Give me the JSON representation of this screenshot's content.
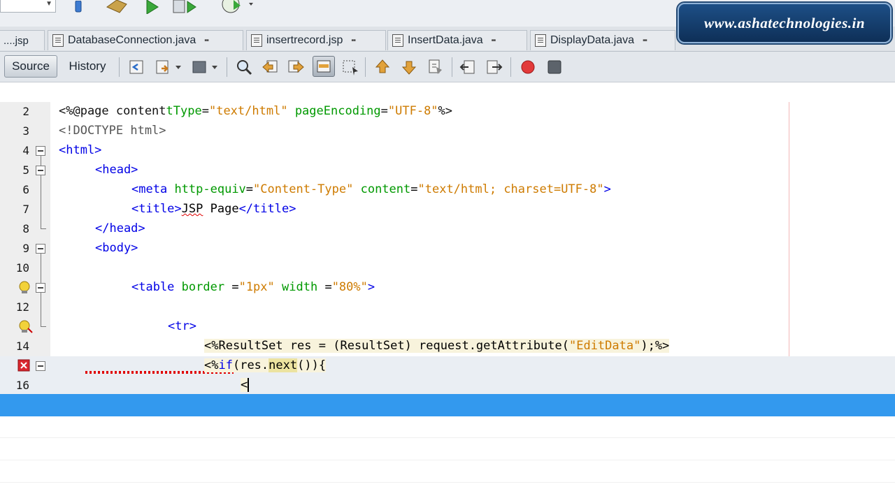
{
  "watermark": {
    "text": "www.ashatechnologies.in"
  },
  "tabs": [
    {
      "label": "....jsp"
    },
    {
      "label": "DatabaseConnection.java"
    },
    {
      "label": "insertrecord.jsp"
    },
    {
      "label": "InsertData.java"
    },
    {
      "label": "DisplayData.java"
    }
  ],
  "editor_toolbar": {
    "source_label": "Source",
    "history_label": "History"
  },
  "code_lines": [
    {
      "num": "2",
      "text": "<%@page contentType=\"text/html\" pageEncoding=\"UTF-8\"%>"
    },
    {
      "num": "3",
      "text": "<!DOCTYPE html>"
    },
    {
      "num": "4",
      "text": "<html>"
    },
    {
      "num": "5",
      "text": "<head>"
    },
    {
      "num": "6",
      "text": "<meta http-equiv=\"Content-Type\" content=\"text/html; charset=UTF-8\">"
    },
    {
      "num": "7",
      "text": "<title>JSP Page</title>"
    },
    {
      "num": "8",
      "text": "</head>"
    },
    {
      "num": "9",
      "text": "<body>"
    },
    {
      "num": "10",
      "text": ""
    },
    {
      "num": "",
      "text": "<table border =\"1px\" width =\"80%\">"
    },
    {
      "num": "12",
      "text": ""
    },
    {
      "num": "",
      "text": "<tr>"
    },
    {
      "num": "14",
      "text": "<%ResultSet res = (ResultSet) request.getAttribute(\"EditData\");%>"
    },
    {
      "num": "",
      "text": "<%if(res.next()){"
    },
    {
      "num": "16",
      "text": "<"
    }
  ],
  "colors": {
    "accent_bar": "#3399ee",
    "tag": "#0000e6",
    "attribute": "#009900",
    "string": "#ce7b00",
    "error": "#e00000"
  }
}
